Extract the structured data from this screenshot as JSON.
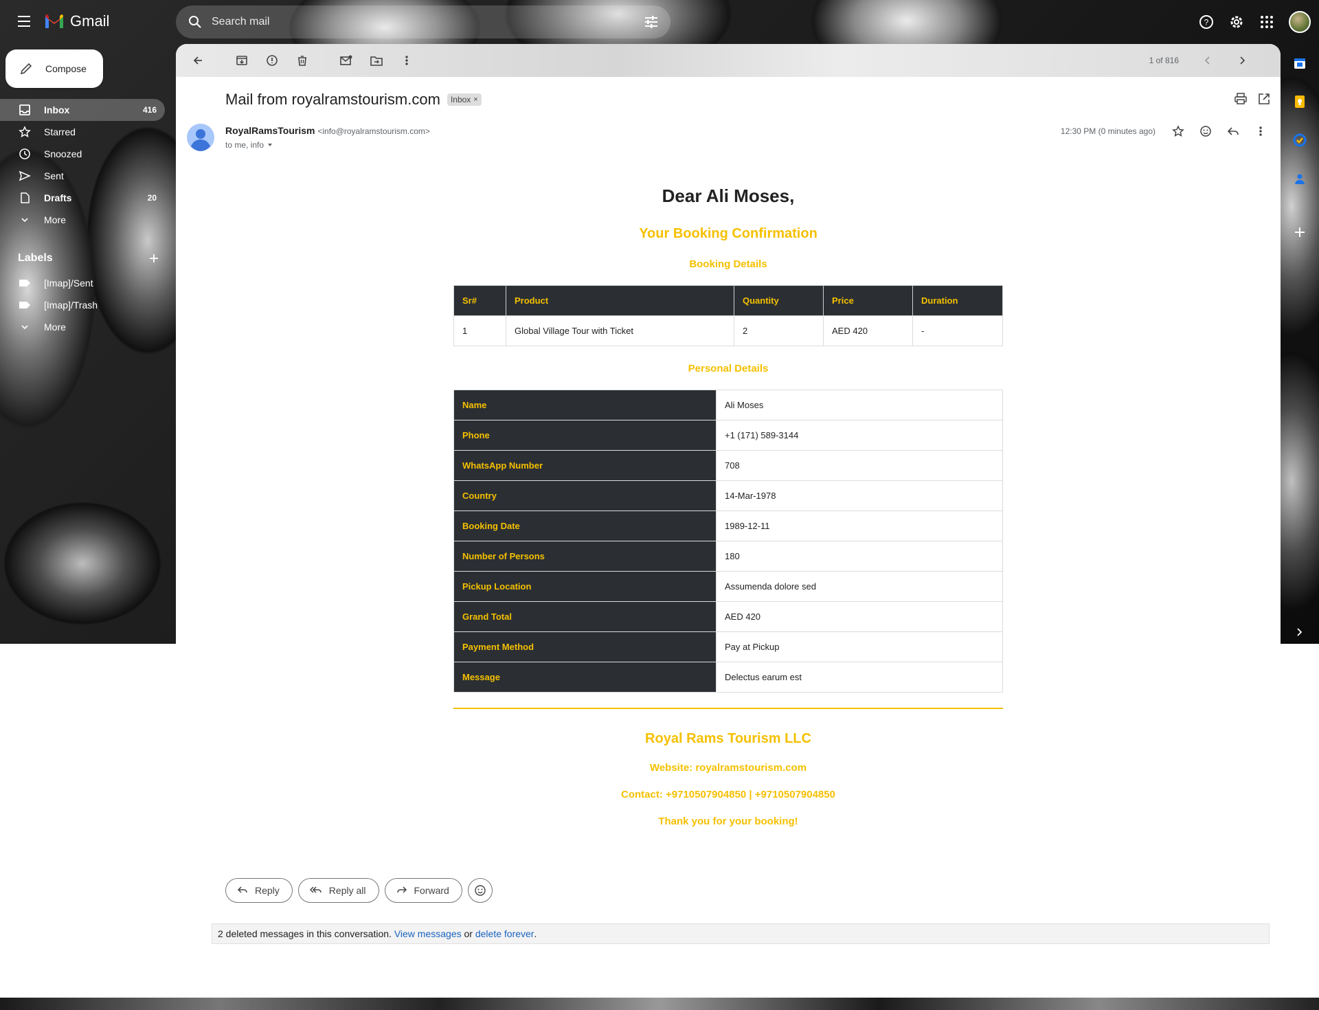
{
  "app": {
    "name": "Gmail"
  },
  "search": {
    "placeholder": "Search mail"
  },
  "compose": {
    "label": "Compose"
  },
  "nav": [
    {
      "label": "Inbox",
      "count": "416",
      "icon": "inbox-icon"
    },
    {
      "label": "Starred",
      "count": "",
      "icon": "star-icon"
    },
    {
      "label": "Snoozed",
      "count": "",
      "icon": "clock-icon"
    },
    {
      "label": "Sent",
      "count": "",
      "icon": "send-icon"
    },
    {
      "label": "Drafts",
      "count": "20",
      "icon": "draft-icon"
    },
    {
      "label": "More",
      "count": "",
      "icon": "chevron-down-icon"
    }
  ],
  "labels": {
    "title": "Labels",
    "items": [
      "[Imap]/Sent",
      "[Imap]/Trash"
    ],
    "more": "More"
  },
  "toolbar": {
    "pager": "1 of 816"
  },
  "message": {
    "subject": "Mail from royalramstourism.com",
    "chip": "Inbox",
    "sender_name": "RoyalRamsTourism",
    "sender_email": "<info@royalramstourism.com>",
    "recipients": "to me, info",
    "time": "12:30 PM (0 minutes ago)"
  },
  "email": {
    "greeting": "Dear Ali Moses,",
    "confirmation": "Your Booking Confirmation",
    "booking_heading": "Booking Details",
    "booking_headers": [
      "Sr#",
      "Product",
      "Quantity",
      "Price",
      "Duration"
    ],
    "booking_row": [
      "1",
      "Global Village Tour with Ticket",
      "2",
      "AED 420",
      "-"
    ],
    "personal_heading": "Personal Details",
    "personal": [
      {
        "k": "Name",
        "v": "Ali Moses"
      },
      {
        "k": "Phone",
        "v": "+1 (171) 589-3144"
      },
      {
        "k": "WhatsApp Number",
        "v": "708"
      },
      {
        "k": "Country",
        "v": "14-Mar-1978"
      },
      {
        "k": "Booking Date",
        "v": "1989-12-11"
      },
      {
        "k": "Number of Persons",
        "v": "180"
      },
      {
        "k": "Pickup Location",
        "v": "Assumenda dolore sed"
      },
      {
        "k": "Grand Total",
        "v": "AED 420"
      },
      {
        "k": "Payment Method",
        "v": "Pay at Pickup"
      },
      {
        "k": "Message",
        "v": "Delectus earum est"
      }
    ],
    "company": "Royal Rams Tourism LLC",
    "website": "Website: royalramstourism.com",
    "contact": "Contact: +9710507904850 | +9710507904850",
    "thanks": "Thank you for your booking!"
  },
  "actions": {
    "reply": "Reply",
    "reply_all": "Reply all",
    "forward": "Forward"
  },
  "deleted": {
    "text": "2 deleted messages in this conversation.",
    "view": "View messages",
    "or": "or",
    "delete": "delete forever",
    "period": "."
  },
  "colors": {
    "accent": "#f5c000",
    "table_dark": "#2b2f33",
    "link": "#1a63c0"
  }
}
